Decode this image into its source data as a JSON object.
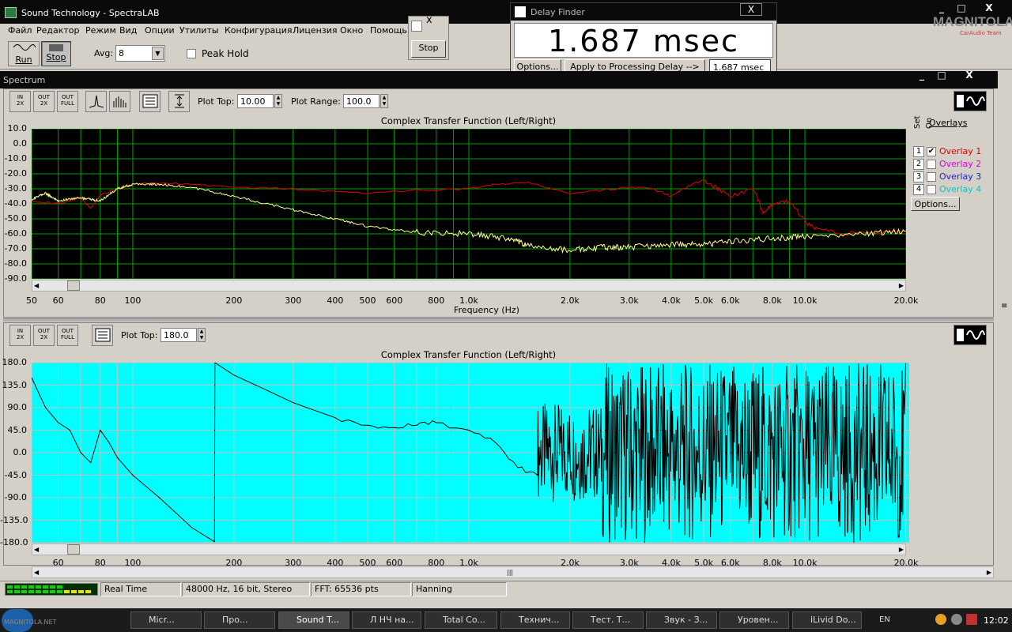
{
  "window": {
    "title": "Sound Technology - SpectraLAB",
    "minimize": "_",
    "maximize": "□",
    "close": "X"
  },
  "logo": {
    "main": "MAGNITOLA",
    "sub": "CarAudio Team"
  },
  "menu": [
    "Файл",
    "Редактор",
    "Режим",
    "Вид",
    "Опции",
    "Утилиты",
    "Конфигурация",
    "Лицензия",
    "Окно",
    "Помощь"
  ],
  "toolbar": {
    "run_label": "Run",
    "stop_label": "Stop",
    "avg_label": "Avg:",
    "avg_value": "8",
    "peak_hold_label": "Peak Hold"
  },
  "stop_popup": {
    "close": "x",
    "stop_label": "Stop"
  },
  "delay_finder": {
    "title": "Delay Finder",
    "close": "X",
    "value": "1.687 msec",
    "options_label": "Options...",
    "apply_label": "Apply to Processing Delay -->",
    "applied_value": "1.687 msec"
  },
  "spectrum_window": {
    "title": "Spectrum",
    "minimize": "_",
    "maximize": "□",
    "close": "X"
  },
  "zoom_buttons": {
    "in": [
      "IN",
      "2X"
    ],
    "out2x": [
      "OUT",
      "2X"
    ],
    "outfull": [
      "OUT",
      "FULL"
    ]
  },
  "top_plot": {
    "plot_top_label": "Plot Top:",
    "plot_top_value": "10.00",
    "plot_range_label": "Plot Range:",
    "plot_range_value": "100.0",
    "title": "Complex Transfer Function (Left/Right)",
    "xlabel": "Frequency (Hz)",
    "y_ticks": [
      "10.0",
      "0.0",
      "-10.0",
      "-20.0",
      "-30.0",
      "-40.0",
      "-50.0",
      "-60.0",
      "-70.0",
      "-80.0",
      "-90.0"
    ],
    "x_ticks": [
      "50",
      "60",
      "80",
      "100",
      "200",
      "300",
      "400",
      "500",
      "600",
      "800",
      "1.0k",
      "2.0k",
      "3.0k",
      "4.0k",
      "5.0k",
      "6.0k",
      "8.0k",
      "10.0k",
      "20.0k"
    ]
  },
  "overlays": {
    "heading": "Overlays",
    "set_label": "Set",
    "on_label": "On",
    "items": [
      {
        "num": "1",
        "label": "Overlay 1",
        "color": "#e00000",
        "checked": true
      },
      {
        "num": "2",
        "label": "Overlay 2",
        "color": "#e000e0",
        "checked": false
      },
      {
        "num": "3",
        "label": "Overlay 3",
        "color": "#2020d0",
        "checked": false
      },
      {
        "num": "4",
        "label": "Overlay 4",
        "color": "#00c8c8",
        "checked": false
      }
    ],
    "options_label": "Options..."
  },
  "bottom_plot": {
    "plot_top_label": "Plot Top:",
    "plot_top_value": "180.0",
    "title": "Complex Transfer Function (Left/Right)",
    "y_ticks": [
      "180.0",
      "135.0",
      "90.0",
      "45.0",
      "0.0",
      "-45.0",
      "-90.0",
      "-135.0",
      "-180.0"
    ],
    "x_ticks": [
      "60",
      "80",
      "100",
      "200",
      "300",
      "400",
      "500",
      "600",
      "800",
      "1.0k",
      "2.0k",
      "3.0k",
      "4.0k",
      "5.0k",
      "6.0k",
      "8.0k",
      "10.0k",
      "20.0k"
    ]
  },
  "status": {
    "mode": "Real Time",
    "format": "48000 Hz, 16 bit, Stereo",
    "fft": "FFT: 65536 pts",
    "window": "Hanning"
  },
  "taskbar": {
    "tasks": [
      "Micr...",
      "Про...",
      "Sound T...",
      "Л НЧ на...",
      "Total Co...",
      "Технич...",
      "Тест. Т...",
      "Звук - З...",
      "Уровен...",
      "iLivid Do..."
    ],
    "lang": "EN",
    "clock": "12:02",
    "watermark": "MAGNITOLA.NET"
  },
  "colors": {
    "plot_bg": "#000000",
    "grid": "#00a000",
    "overlay_red": "#e00000",
    "live_yellow": "#ffff90",
    "phase_bg": "#00ffff"
  },
  "chart_data": [
    {
      "type": "line",
      "title": "Complex Transfer Function (Left/Right)",
      "xlabel": "Frequency (Hz)",
      "ylabel": "",
      "x_scale": "log",
      "xlim": [
        50,
        20000
      ],
      "ylim": [
        -90,
        10
      ],
      "grid": true,
      "series": [
        {
          "name": "Overlay 1",
          "color": "#e00000",
          "x": [
            50,
            60,
            70,
            75,
            80,
            90,
            100,
            120,
            150,
            200,
            300,
            400,
            500,
            700,
            1000,
            1200,
            1500,
            2000,
            2500,
            3000,
            3500,
            4000,
            4500,
            5000,
            5500,
            6000,
            7000,
            7500,
            8000,
            9000,
            10000,
            11000,
            13000,
            15000,
            20000
          ],
          "y": [
            -38,
            -40,
            -36,
            -43,
            -34,
            -30,
            -27,
            -26,
            -27,
            -29,
            -30,
            -32,
            -33,
            -31,
            -30,
            -27,
            -26,
            -33,
            -31,
            -29,
            -30,
            -35,
            -28,
            -24,
            -30,
            -35,
            -30,
            -45,
            -41,
            -38,
            -52,
            -57,
            -60,
            -59,
            -58
          ]
        },
        {
          "name": "",
          "color": "#ffff90",
          "x": [
            50,
            55,
            60,
            70,
            80,
            90,
            100,
            120,
            150,
            200,
            300,
            400,
            500,
            700,
            1000,
            1300,
            1500,
            2000,
            2500,
            3000,
            4000,
            5000,
            6000,
            8000,
            10000,
            15000,
            20000
          ],
          "y": [
            -37,
            -33,
            -38,
            -36,
            -38,
            -30,
            -27,
            -27,
            -29,
            -35,
            -44,
            -50,
            -55,
            -59,
            -60,
            -63,
            -68,
            -71,
            -69,
            -69,
            -67,
            -67,
            -65,
            -63,
            -62,
            -60,
            -58
          ]
        }
      ]
    },
    {
      "type": "line",
      "title": "Complex Transfer Function (Left/Right)",
      "xlabel": "",
      "ylabel": "",
      "x_scale": "log",
      "xlim": [
        50,
        20000
      ],
      "ylim": [
        -180,
        180
      ],
      "grid": true,
      "series": [
        {
          "name": "",
          "color": "#000000",
          "x": [
            50,
            55,
            60,
            65,
            70,
            75,
            80,
            85,
            90,
            100,
            120,
            150,
            175,
            175.5,
            200,
            250,
            300,
            400,
            500,
            600,
            700,
            800,
            1000,
            1200,
            1400,
            1600
          ],
          "y": [
            150,
            90,
            60,
            45,
            0,
            -20,
            45,
            20,
            -10,
            -45,
            -90,
            -150,
            -178,
            180,
            155,
            125,
            100,
            70,
            55,
            50,
            55,
            60,
            45,
            20,
            -30,
            -45
          ]
        }
      ],
      "noise_region_hz": [
        1600,
        20000
      ]
    }
  ]
}
